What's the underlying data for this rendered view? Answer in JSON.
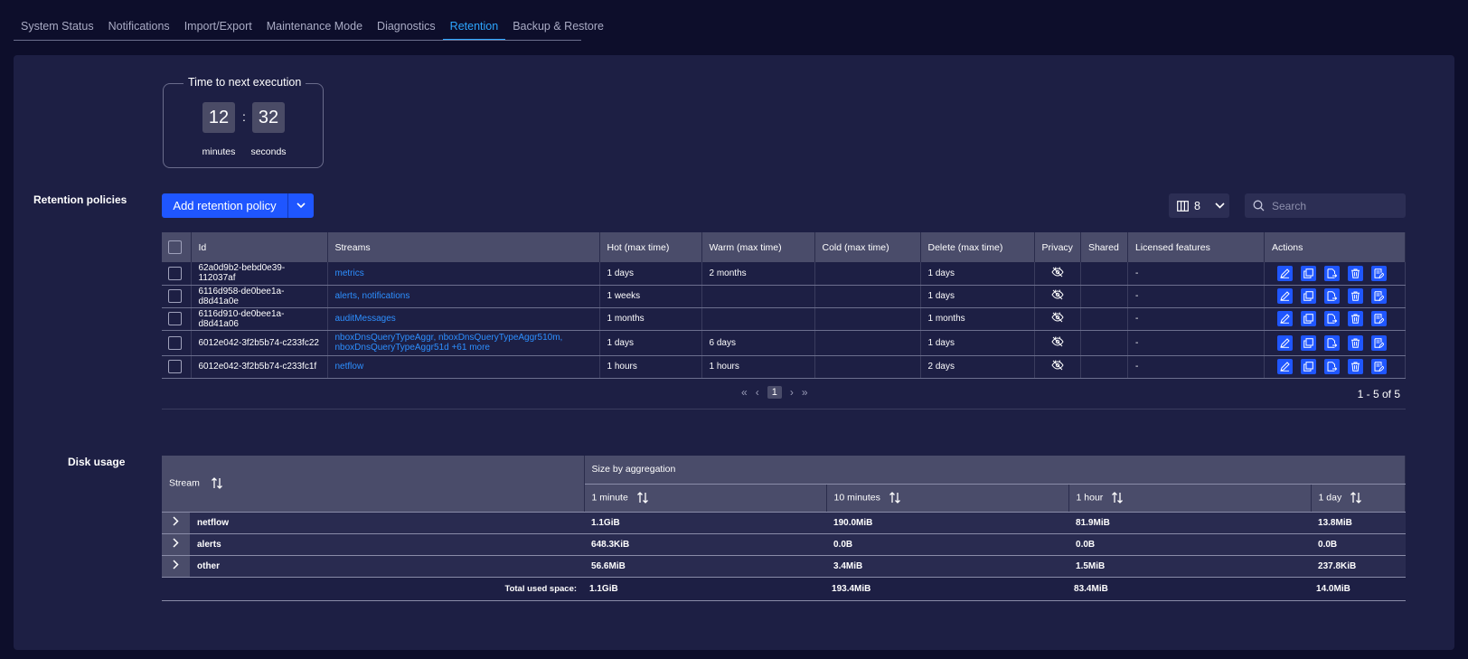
{
  "tabs": [
    {
      "label": "System Status",
      "active": false
    },
    {
      "label": "Notifications",
      "active": false
    },
    {
      "label": "Import/Export",
      "active": false
    },
    {
      "label": "Maintenance Mode",
      "active": false
    },
    {
      "label": "Diagnostics",
      "active": false
    },
    {
      "label": "Retention",
      "active": true
    },
    {
      "label": "Backup & Restore",
      "active": false
    }
  ],
  "countdown": {
    "title": "Time to next execution",
    "minutes": "12",
    "seconds": "32",
    "minutes_label": "minutes",
    "seconds_label": "seconds",
    "separator": ":"
  },
  "retention": {
    "section_title": "Retention policies",
    "add_button": "Add retention policy",
    "columns_count": "8",
    "search_placeholder": "Search",
    "headers": [
      "Id",
      "Streams",
      "Hot (max time)",
      "Warm (max time)",
      "Cold (max time)",
      "Delete (max time)",
      "Privacy",
      "Shared",
      "Licensed features",
      "Actions"
    ],
    "rows": [
      {
        "id": "62a0d9b2-bebd0e39-112037af",
        "streams": [
          "metrics"
        ],
        "hot": "1 days",
        "warm": "2 months",
        "cold": "",
        "delete": "1 days",
        "shared": "",
        "licensed": "-"
      },
      {
        "id": "6116d958-de0bee1a-d8d41a0e",
        "streams": [
          "alerts, notifications"
        ],
        "hot": "1 weeks",
        "warm": "",
        "cold": "",
        "delete": "1 days",
        "shared": "",
        "licensed": "-"
      },
      {
        "id": "6116d910-de0bee1a-d8d41a06",
        "streams": [
          "auditMessages"
        ],
        "hot": "1 months",
        "warm": "",
        "cold": "",
        "delete": "1 months",
        "shared": "",
        "licensed": "-"
      },
      {
        "id": "6012e042-3f2b5b74-c233fc22",
        "streams": [
          "nboxDnsQueryTypeAggr, nboxDnsQueryTypeAggr510m,",
          "nboxDnsQueryTypeAggr51d +61 more"
        ],
        "hot": "1 days",
        "warm": "6 days",
        "cold": "",
        "delete": "1 days",
        "shared": "",
        "licensed": "-"
      },
      {
        "id": "6012e042-3f2b5b74-c233fc1f",
        "streams": [
          "netflow"
        ],
        "hot": "1 hours",
        "warm": "1 hours",
        "cold": "",
        "delete": "2 days",
        "shared": "",
        "licensed": "-"
      }
    ],
    "pager": {
      "current": "1",
      "range": "1 - 5 of 5"
    }
  },
  "disk": {
    "section_title": "Disk usage",
    "stream_header": "Stream",
    "group_header": "Size by aggregation",
    "agg_headers": [
      "1 minute",
      "10 minutes",
      "1 hour",
      "1 day"
    ],
    "rows": [
      {
        "stream": "netflow",
        "values": [
          "1.1GiB",
          "190.0MiB",
          "81.9MiB",
          "13.8MiB"
        ]
      },
      {
        "stream": "alerts",
        "values": [
          "648.3KiB",
          "0.0B",
          "0.0B",
          "0.0B"
        ]
      },
      {
        "stream": "other",
        "values": [
          "56.6MiB",
          "3.4MiB",
          "1.5MiB",
          "237.8KiB"
        ]
      }
    ],
    "total_label": "Total used space:",
    "totals": [
      "1.1GiB",
      "193.4MiB",
      "83.4MiB",
      "14.0MiB"
    ]
  },
  "colors": {
    "accent": "#1f56ff",
    "link": "#2d8fff",
    "active_tab": "#2da6ff",
    "panel": "#1d1f44"
  }
}
